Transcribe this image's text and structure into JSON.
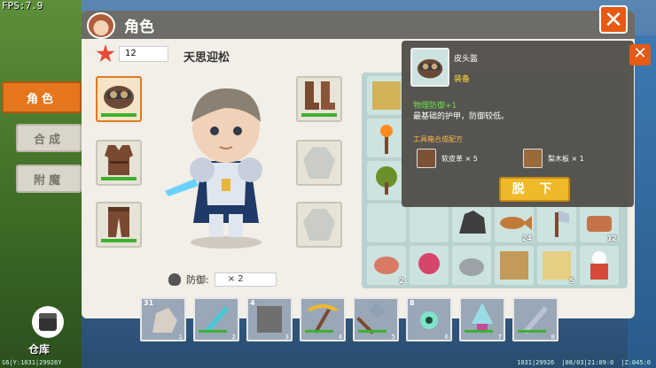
{
  "hud": {
    "fps": "FPS:7.9",
    "bottom_left": "S6|Y:1031|29926Y",
    "bottom_right_1": "1031|29926",
    "bottom_right_2": "|08/03|21:09:0",
    "bottom_right_3": "|Z:045:0"
  },
  "tabs": [
    {
      "label": "角色"
    },
    {
      "label": "合成"
    },
    {
      "label": "附魔"
    }
  ],
  "window": {
    "title": "角色"
  },
  "player": {
    "level": "12",
    "name": "天思迎松",
    "defense_label": "防御:",
    "defense_value": "× 2"
  },
  "tooltip": {
    "item_name": "皮头盔",
    "slot_tag": "装备",
    "stat": "物理防御+1",
    "description": "最基础的护甲，防御较低。",
    "recipe_title": "工具箱合成配方",
    "materials": [
      {
        "name": "软皮革 × 5"
      },
      {
        "name": "梨木板 × 1"
      }
    ],
    "unequip_label": "脱 下"
  },
  "grid_counts": {
    "log": "24",
    "apples": "12",
    "meat": "2",
    "pudding": "5"
  },
  "hotbar": [
    {
      "index": "1",
      "qty": "31",
      "icon": "ore-icon"
    },
    {
      "index": "2",
      "qty": "",
      "icon": "diamond-sword-icon"
    },
    {
      "index": "3",
      "qty": "4",
      "icon": "stone-block-icon"
    },
    {
      "index": "4",
      "qty": "",
      "icon": "gold-pickaxe-icon"
    },
    {
      "index": "5",
      "qty": "",
      "icon": "shovel-icon"
    },
    {
      "index": "6",
      "qty": "8",
      "icon": "eye-icon"
    },
    {
      "index": "7",
      "qty": "",
      "icon": "drill-icon"
    },
    {
      "index": "8",
      "qty": "",
      "icon": "iron-sword-icon"
    }
  ],
  "warehouse": {
    "label": "仓库"
  }
}
